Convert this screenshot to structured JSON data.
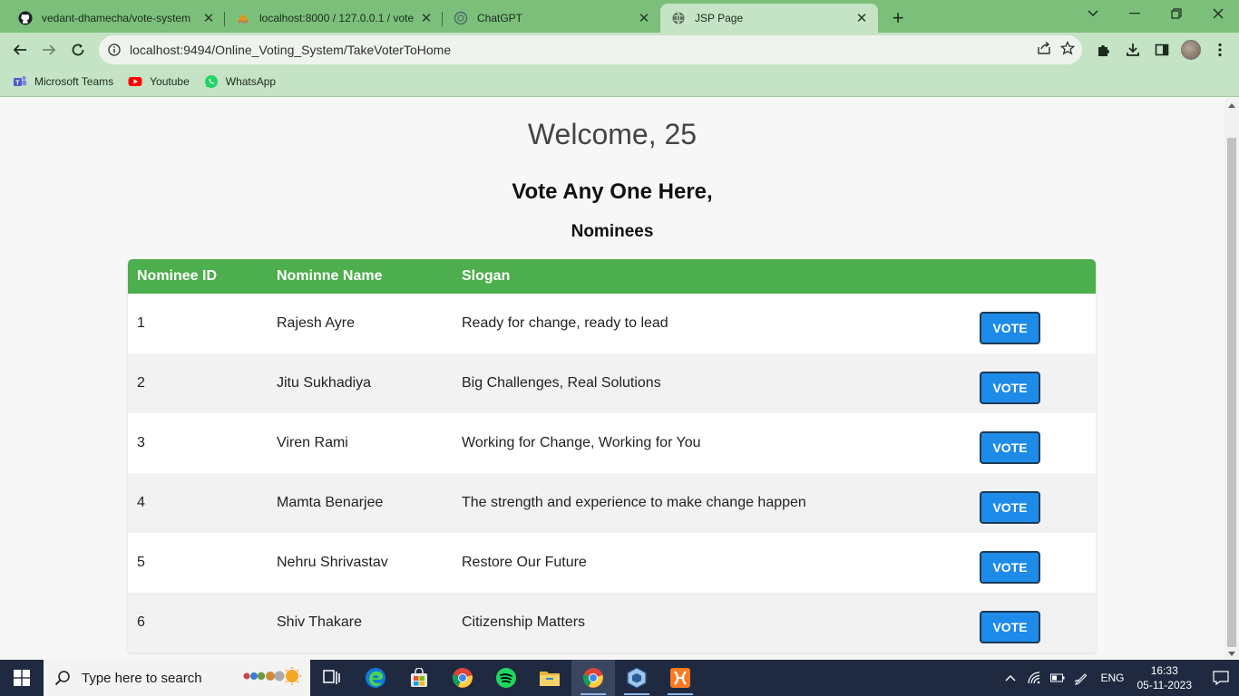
{
  "browser": {
    "tabs": [
      {
        "title": "vedant-dhamecha/vote-system",
        "icon": "github-icon",
        "active": false
      },
      {
        "title": "localhost:8000 / 127.0.0.1 / vote",
        "icon": "phpmyadmin-icon",
        "active": false
      },
      {
        "title": "ChatGPT",
        "icon": "chatgpt-icon",
        "active": false
      },
      {
        "title": "JSP Page",
        "icon": "globe-icon",
        "active": true
      }
    ],
    "url": "localhost:9494/Online_Voting_System/TakeVoterToHome",
    "bookmarks": [
      {
        "label": "Microsoft Teams",
        "icon": "teams-icon"
      },
      {
        "label": "Youtube",
        "icon": "youtube-icon"
      },
      {
        "label": "WhatsApp",
        "icon": "whatsapp-icon"
      }
    ]
  },
  "page": {
    "welcome": "Welcome, 25",
    "subheading": "Vote Any One Here,",
    "section_title": "Nominees",
    "table": {
      "headers": [
        "Nominee ID",
        "Nominne Name",
        "Slogan",
        ""
      ],
      "rows": [
        {
          "id": "1",
          "name": "Rajesh Ayre",
          "slogan": "Ready for change, ready to lead",
          "button": "VOTE"
        },
        {
          "id": "2",
          "name": "Jitu Sukhadiya",
          "slogan": "Big Challenges, Real Solutions",
          "button": "VOTE"
        },
        {
          "id": "3",
          "name": "Viren Rami",
          "slogan": "Working for Change, Working for You",
          "button": "VOTE"
        },
        {
          "id": "4",
          "name": "Mamta Benarjee",
          "slogan": "The strength and experience to make change happen",
          "button": "VOTE"
        },
        {
          "id": "5",
          "name": "Nehru Shrivastav",
          "slogan": "Restore Our Future",
          "button": "VOTE"
        },
        {
          "id": "6",
          "name": "Shiv Thakare",
          "slogan": "Citizenship Matters",
          "button": "VOTE"
        }
      ]
    },
    "colors": {
      "header_green": "#4cae4c",
      "vote_blue": "#1e8be8",
      "browser_green": "#7bbf7b"
    }
  },
  "taskbar": {
    "search_placeholder": "Type here to search",
    "language": "ENG",
    "time": "16:33",
    "date": "05-11-2023"
  }
}
